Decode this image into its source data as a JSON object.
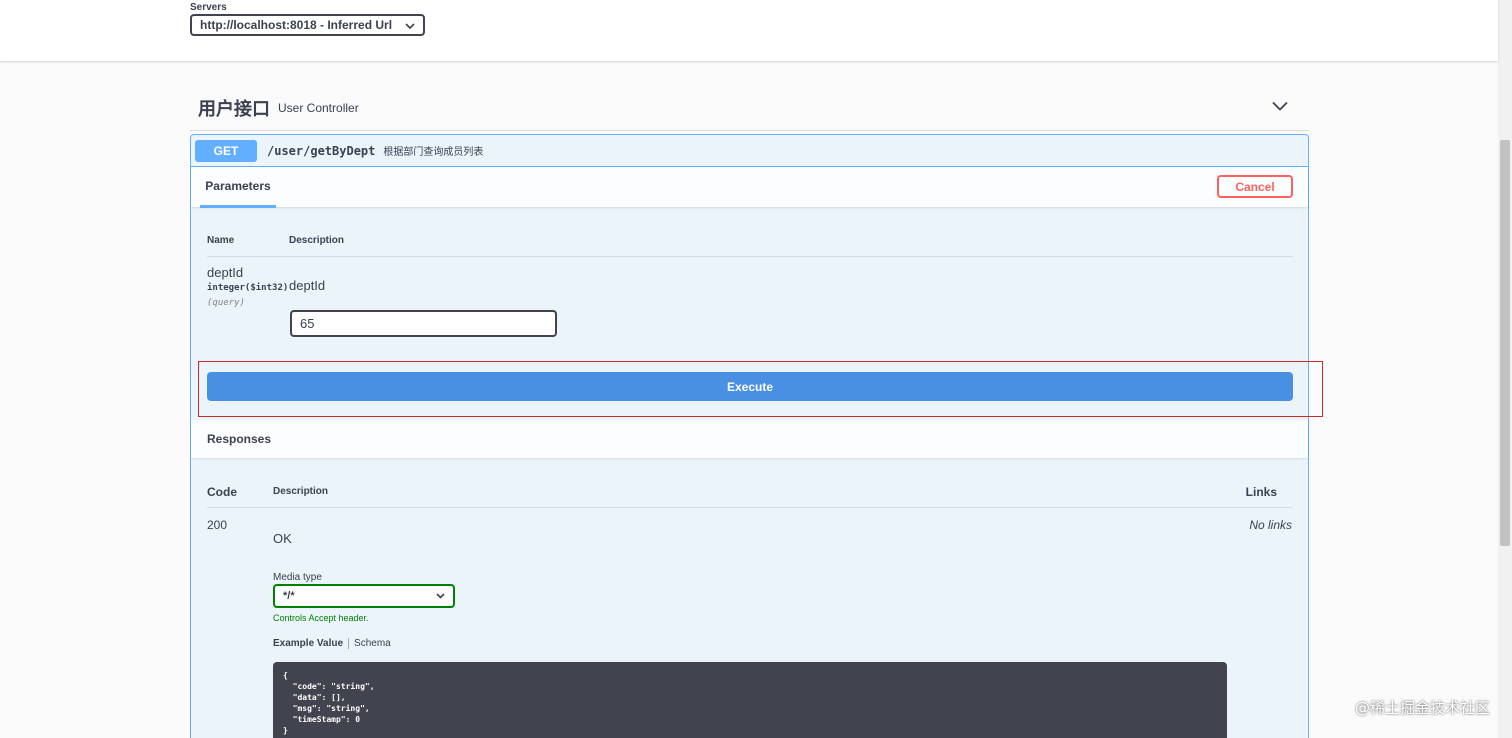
{
  "servers": {
    "label": "Servers",
    "selected": "http://localhost:8018 - Inferred Url"
  },
  "tag": {
    "title": "用户接口",
    "description": "User Controller"
  },
  "operation": {
    "method": "GET",
    "path": "/user/getByDept",
    "summary": "根据部门查询成员列表"
  },
  "parameters": {
    "tab_label": "Parameters",
    "cancel_label": "Cancel",
    "col_name": "Name",
    "col_description": "Description",
    "items": [
      {
        "name": "deptId",
        "type": "integer($int32)",
        "in": "(query)",
        "description": "deptId",
        "value": "65"
      }
    ]
  },
  "execute_label": "Execute",
  "responses": {
    "title": "Responses",
    "col_code": "Code",
    "col_description": "Description",
    "col_links": "Links",
    "items": [
      {
        "code": "200",
        "description": "OK",
        "links": "No links",
        "media_type_label": "Media type",
        "media_type": "*/*",
        "media_note": "Controls Accept header.",
        "example_tab": "Example Value",
        "schema_tab": "Schema",
        "example": "{\n  \"code\": \"string\",\n  \"data\": [],\n  \"msg\": \"string\",\n  \"timeStamp\": 0\n}"
      }
    ]
  },
  "watermark": "@稀土掘金技术社区",
  "colors": {
    "get_method": "#61affe",
    "execute": "#4990e2",
    "cancel": "#ff6060",
    "media_border": "#008000",
    "highlight": "#cc2a2a"
  }
}
